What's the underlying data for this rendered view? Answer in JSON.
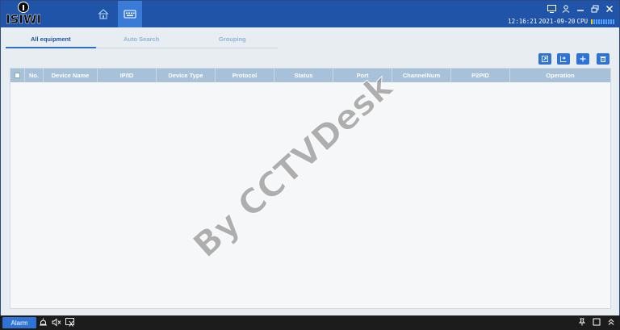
{
  "brand": {
    "logo_text": "ISIWI"
  },
  "titlebar": {
    "time": "12:16:21",
    "date": "2021-09-20",
    "cpu_label": "CPU",
    "cpu_bars_total": 10,
    "cpu_bars_on": 1
  },
  "nav": {
    "home_icon": "home-icon",
    "device_icon": "device-manager-icon"
  },
  "tabs": [
    {
      "label": "All equipment",
      "active": true
    },
    {
      "label": "Auto Search",
      "active": false
    },
    {
      "label": "Grouping",
      "active": false
    }
  ],
  "toolbar": {
    "buttons": [
      {
        "icon": "import-icon"
      },
      {
        "icon": "export-icon"
      },
      {
        "icon": "add-icon"
      },
      {
        "icon": "delete-icon"
      }
    ]
  },
  "table": {
    "columns": [
      "No.",
      "Device Name",
      "IP/ID",
      "Device Type",
      "Protocol",
      "Status",
      "Port",
      "ChannelNum",
      "P2PID",
      "Operation"
    ],
    "rows": []
  },
  "watermark": "By CCTVDesk",
  "taskbar": {
    "alarm_label": "Alarm"
  },
  "colors": {
    "titlebar": "#1f54a8",
    "accent": "#2f73d6",
    "table_header": "#a7c1d8"
  }
}
